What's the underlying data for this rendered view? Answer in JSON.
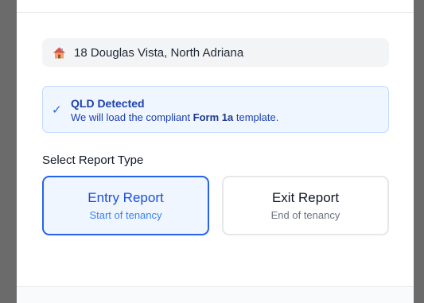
{
  "property": {
    "icon": "house-icon",
    "address": "18 Douglas Vista, North Adriana"
  },
  "alert": {
    "icon": "check-icon",
    "title": "QLD Detected",
    "message_prefix": "We will load the compliant ",
    "message_bold": "Form 1a",
    "message_suffix": " template."
  },
  "report_type": {
    "label": "Select Report Type",
    "options": [
      {
        "title": "Entry Report",
        "subtitle": "Start of tenancy",
        "selected": true
      },
      {
        "title": "Exit Report",
        "subtitle": "End of tenancy",
        "selected": false
      }
    ]
  },
  "colors": {
    "accent": "#2563eb",
    "selected_bg": "#eff6ff",
    "alert_border": "#bfdbfe"
  }
}
